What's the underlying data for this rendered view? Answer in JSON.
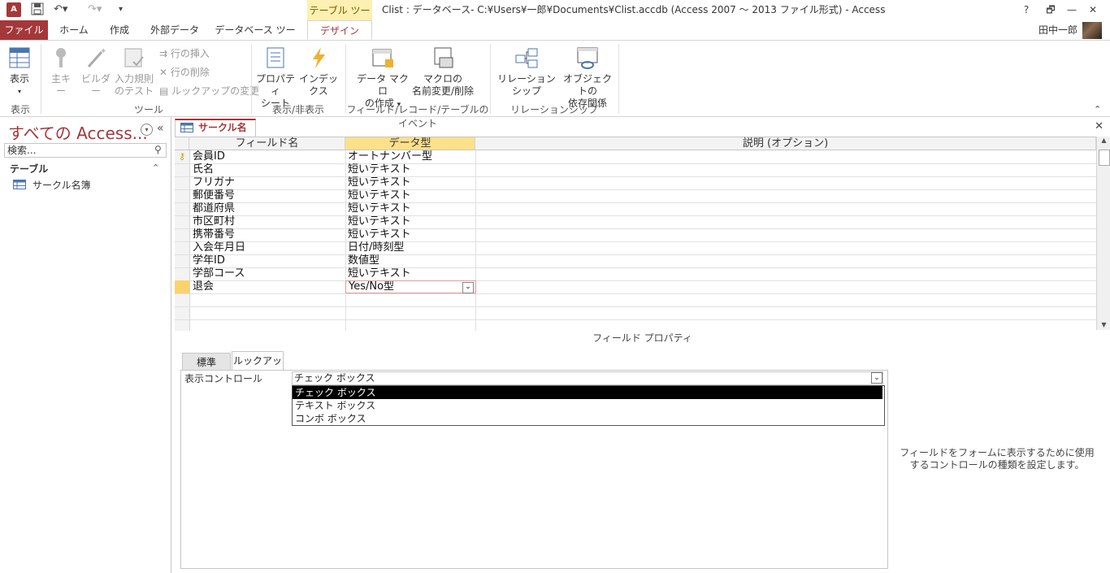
{
  "titlebar": {
    "app_icon": "A",
    "context_tool": "テーブル ツール",
    "window_title": "Clist : データベース- C:¥Users¥一郎¥Documents¥Clist.accdb (Access 2007 ～ 2013 ファイル形式) - Access",
    "help": "?",
    "restore": "🗗",
    "min": "—",
    "max": "🗗",
    "close": "✕"
  },
  "tabs": {
    "file": "ファイル",
    "home": "ホーム",
    "create": "作成",
    "external": "外部データ",
    "dbtools": "データベース ツール",
    "design": "デザイン"
  },
  "user": {
    "name": "田中一郎"
  },
  "ribbon": {
    "view": {
      "label1": "表示"
    },
    "tools": {
      "primary_key": "主キー",
      "builder": "ビルダー",
      "test_rules_1": "入力規則",
      "test_rules_2": "のテスト",
      "insert_row": "行の挿入",
      "delete_row": "行の削除",
      "lookup_change": "ルックアップの変更"
    },
    "showhide": {
      "prop_1": "プロパティ",
      "prop_2": "シート",
      "index": "インデックス"
    },
    "events": {
      "data_macro_1": "データ マクロ",
      "data_macro_2": "の作成",
      "rename_1": "マクロの",
      "rename_2": "名前変更/削除"
    },
    "relations": {
      "rel": "リレーションシップ",
      "dep_1": "オブジェクトの",
      "dep_2": "依存関係"
    },
    "groups": {
      "view": "表示",
      "tools": "ツール",
      "showhide": "表示/非表示",
      "events": "フィールド/レコード/テーブルのイベント",
      "relations": "リレーションシップ"
    }
  },
  "navpane": {
    "title": "すべての Access...",
    "search_placeholder": "検索...",
    "section": "テーブル",
    "items": [
      "サークル名簿"
    ]
  },
  "document": {
    "tab": "サークル名簿",
    "headers": {
      "field": "フィールド名",
      "type": "データ型",
      "desc": "説明 (オプション)"
    },
    "rows": [
      {
        "field": "会員ID",
        "type": "オートナンバー型"
      },
      {
        "field": "氏名",
        "type": "短いテキスト"
      },
      {
        "field": "フリガナ",
        "type": "短いテキスト"
      },
      {
        "field": "郵便番号",
        "type": "短いテキスト"
      },
      {
        "field": "都道府県",
        "type": "短いテキスト"
      },
      {
        "field": "市区町村",
        "type": "短いテキスト"
      },
      {
        "field": "携帯番号",
        "type": "短いテキスト"
      },
      {
        "field": "入会年月日",
        "type": "日付/時刻型"
      },
      {
        "field": "学年ID",
        "type": "数値型"
      },
      {
        "field": "学部コース",
        "type": "短いテキスト"
      },
      {
        "field": "退会",
        "type": "Yes/No型"
      }
    ],
    "field_properties": "フィールド プロパティ",
    "prop_tabs": {
      "standard": "標準",
      "lookup": "ルックアップ"
    },
    "prop_label": "表示コントロール",
    "prop_value": "チェック ボックス",
    "dropdown_options": [
      "チェック ボックス",
      "テキスト ボックス",
      "コンボ ボックス"
    ],
    "help_text": "フィールドをフォームに表示するために使用するコントロールの種類を設定します。"
  },
  "colors": {
    "accent": "#a4373a",
    "selected": "#000000",
    "context_tab": "#fdf0b0"
  }
}
